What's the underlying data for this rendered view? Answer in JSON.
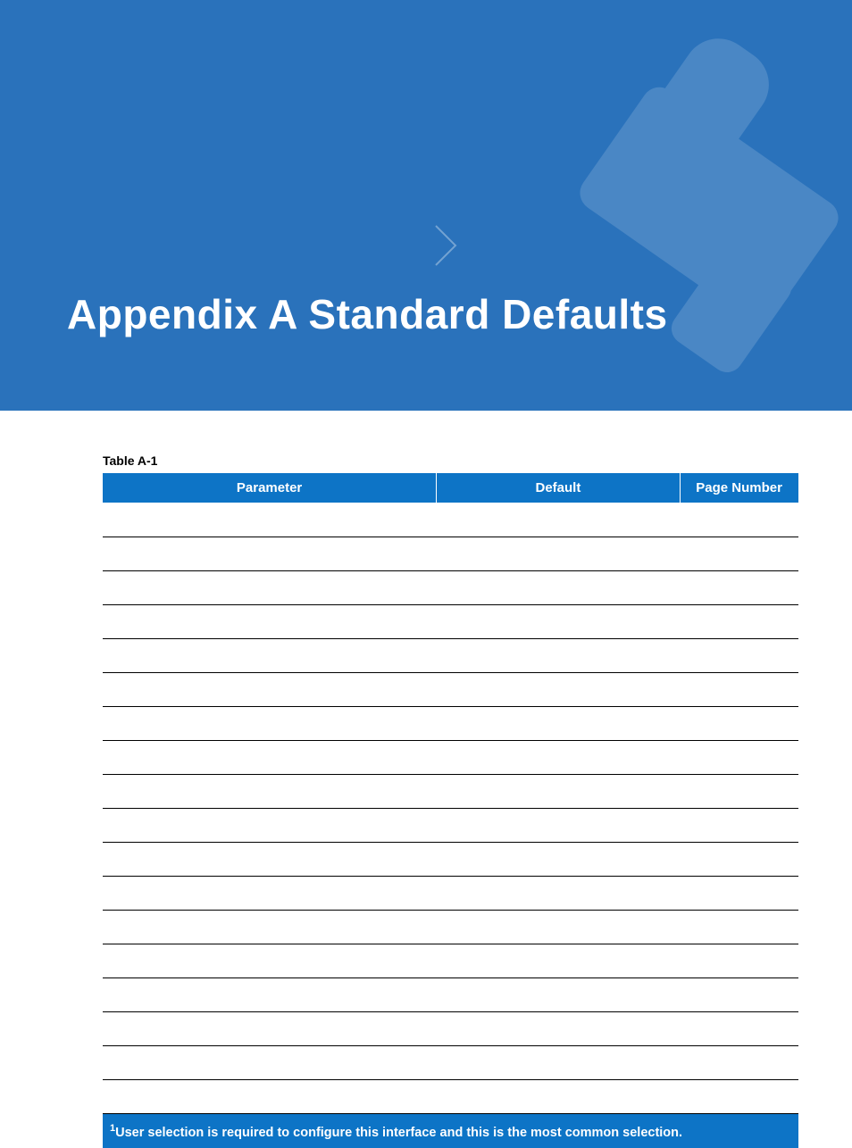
{
  "header": {
    "title": "Appendix A  Standard Defaults"
  },
  "table": {
    "caption": "Table A-1",
    "columns": {
      "parameter": "Parameter",
      "default": "Default",
      "page": "Page Number"
    },
    "rows": [
      {
        "type": "section"
      },
      {
        "type": "data",
        "parameter": "",
        "default": "",
        "page": ""
      },
      {
        "type": "data",
        "parameter": "",
        "default": "",
        "page": ""
      },
      {
        "type": "data",
        "parameter": "",
        "default": "",
        "page": ""
      },
      {
        "type": "data",
        "parameter": "",
        "default": "",
        "page": ""
      },
      {
        "type": "data",
        "parameter": "",
        "default": "",
        "page": ""
      },
      {
        "type": "data",
        "parameter": "",
        "default": "",
        "page": ""
      },
      {
        "type": "data",
        "parameter": "",
        "default": "",
        "page": ""
      },
      {
        "type": "data",
        "parameter": "",
        "default": "",
        "page": ""
      },
      {
        "type": "data",
        "parameter": "",
        "default": "",
        "page": ""
      },
      {
        "type": "data",
        "parameter": "",
        "default": "",
        "page": ""
      },
      {
        "type": "data",
        "parameter": "",
        "default": "",
        "page": ""
      },
      {
        "type": "data",
        "parameter": "",
        "default": "",
        "page": ""
      },
      {
        "type": "data",
        "parameter": "",
        "default": "",
        "page": ""
      },
      {
        "type": "section"
      },
      {
        "type": "data",
        "parameter": "",
        "default": "",
        "page": ""
      },
      {
        "type": "data",
        "parameter": "",
        "default": "",
        "page": ""
      },
      {
        "type": "data",
        "parameter": "",
        "default": "",
        "page": ""
      }
    ],
    "footnote_marker": "1",
    "footnote": "User selection is required to configure this interface and this is the most common selection."
  }
}
